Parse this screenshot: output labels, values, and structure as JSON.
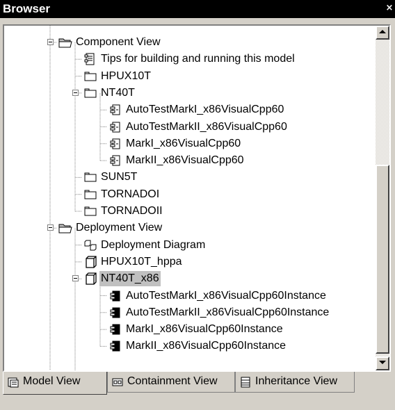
{
  "window": {
    "title": "Browser",
    "close_glyph": "×"
  },
  "tree": {
    "items": [
      {
        "label": "Component View",
        "icon": "folder-open-icon",
        "depth": 0,
        "expander": "minus"
      },
      {
        "label": "Tips for building and running this model",
        "icon": "document-icon",
        "depth": 1
      },
      {
        "label": "HPUX10T",
        "icon": "package-icon",
        "depth": 1
      },
      {
        "label": "NT40T",
        "icon": "package-icon",
        "depth": 1,
        "expander": "minus"
      },
      {
        "label": "AutoTestMarkI_x86VisualCpp60",
        "icon": "component-icon",
        "depth": 2
      },
      {
        "label": "AutoTestMarkII_x86VisualCpp60",
        "icon": "component-icon",
        "depth": 2
      },
      {
        "label": "MarkI_x86VisualCpp60",
        "icon": "component-icon",
        "depth": 2
      },
      {
        "label": "MarkII_x86VisualCpp60",
        "icon": "component-icon",
        "depth": 2
      },
      {
        "label": "SUN5T",
        "icon": "package-icon",
        "depth": 1
      },
      {
        "label": "TORNADOI",
        "icon": "package-icon",
        "depth": 1
      },
      {
        "label": "TORNADOII",
        "icon": "package-icon",
        "depth": 1
      },
      {
        "label": "Deployment View",
        "icon": "folder-open-icon",
        "depth": 0,
        "expander": "minus"
      },
      {
        "label": "Deployment Diagram",
        "icon": "deployment-diagram-icon",
        "depth": 1
      },
      {
        "label": "HPUX10T_hppa",
        "icon": "node-icon",
        "depth": 1
      },
      {
        "label": "NT40T_x86",
        "icon": "node-icon",
        "depth": 1,
        "expander": "minus",
        "selected": true
      },
      {
        "label": "AutoTestMarkI_x86VisualCpp60Instance",
        "icon": "component-instance-icon",
        "depth": 2
      },
      {
        "label": "AutoTestMarkII_x86VisualCpp60Instance",
        "icon": "component-instance-icon",
        "depth": 2
      },
      {
        "label": "MarkI_x86VisualCpp60Instance",
        "icon": "component-instance-icon",
        "depth": 2
      },
      {
        "label": "MarkII_x86VisualCpp60Instance",
        "icon": "component-instance-icon",
        "depth": 2
      }
    ]
  },
  "tabs": [
    {
      "label": "Model View",
      "icon": "model-view-icon",
      "active": true
    },
    {
      "label": "Containment View",
      "icon": "containment-view-icon",
      "active": false
    },
    {
      "label": "Inheritance View",
      "icon": "inheritance-view-icon",
      "active": false
    }
  ],
  "colors": {
    "titlebar": "#000000",
    "background": "#d4d0c8",
    "selection": "#c0c0c0"
  }
}
